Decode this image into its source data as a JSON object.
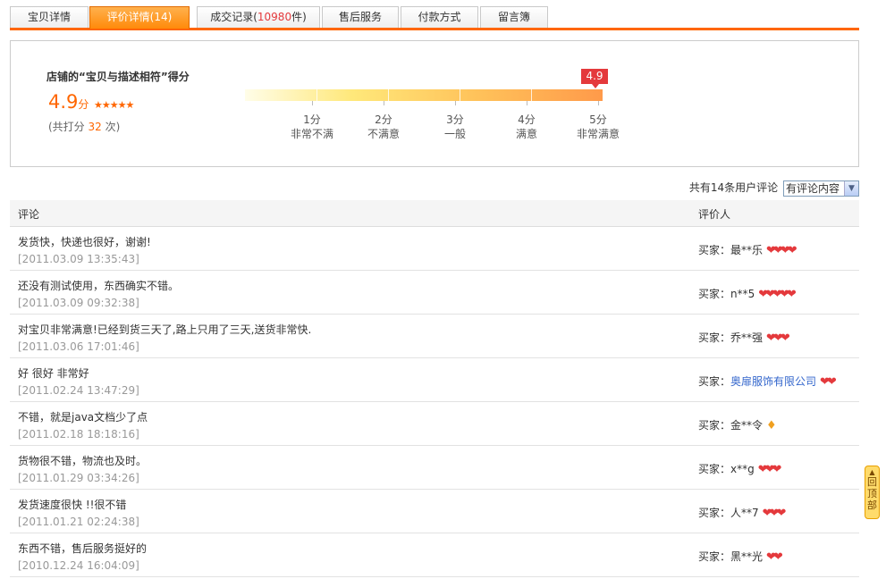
{
  "tabs": [
    {
      "label": "宝贝详情",
      "num": "",
      "suffix": ""
    },
    {
      "label": "评价详情(",
      "num": "14",
      "suffix": ")"
    },
    {
      "label": "成交记录(",
      "num": "10980",
      "suffix": "件)"
    },
    {
      "label": "售后服务",
      "num": "",
      "suffix": ""
    },
    {
      "label": "付款方式",
      "num": "",
      "suffix": ""
    },
    {
      "label": "留言簿",
      "num": "",
      "suffix": ""
    }
  ],
  "rating": {
    "title": "店铺的“宝贝与描述相符”得分",
    "score": "4.9",
    "score_unit": "分",
    "score_value": 4.9,
    "count_prefix": "(共打分",
    "count": "32",
    "count_suffix": "次)",
    "flag": "4.9",
    "scale": [
      {
        "score": "1分",
        "desc": "非常不满"
      },
      {
        "score": "2分",
        "desc": "不满意"
      },
      {
        "score": "3分",
        "desc": "一般"
      },
      {
        "score": "4分",
        "desc": "满意"
      },
      {
        "score": "5分",
        "desc": "非常满意"
      }
    ]
  },
  "sort": {
    "summary": "共有14条用户评论",
    "selected": "有评论内容"
  },
  "table": {
    "col_comment": "评论",
    "col_reviewer": "评价人",
    "rows": [
      {
        "text": "发货快，快递也很好，谢谢!",
        "date": "[2011.03.09 13:35:43]",
        "buyer_prefix": "买家：",
        "buyer": "最**乐",
        "hearts": "❤❤❤❤",
        "link": false,
        "diamond": false
      },
      {
        "text": "还没有测试使用，东西确实不错。",
        "date": "[2011.03.09 09:32:38]",
        "buyer_prefix": "买家：",
        "buyer": "n**5",
        "hearts": "❤❤❤❤❤",
        "link": false,
        "diamond": false
      },
      {
        "text": "对宝贝非常满意!已经到货三天了,路上只用了三天,送货非常快.",
        "date": "[2011.03.06 17:01:46]",
        "buyer_prefix": "买家：",
        "buyer": "乔**强",
        "hearts": "❤❤❤",
        "link": false,
        "diamond": false
      },
      {
        "text": "好 很好 非常好",
        "date": "[2011.02.24 13:47:29]",
        "buyer_prefix": "买家：",
        "buyer": "奥扉服饰有限公司",
        "hearts": "❤❤",
        "link": true,
        "diamond": false
      },
      {
        "text": "不错，就是java文档少了点",
        "date": "[2011.02.18 18:18:16]",
        "buyer_prefix": "买家：",
        "buyer": "金**令",
        "hearts": "♦",
        "link": false,
        "diamond": true
      },
      {
        "text": "货物很不错，物流也及时。",
        "date": "[2011.01.29 03:34:26]",
        "buyer_prefix": "买家：",
        "buyer": "x**g",
        "hearts": "❤❤❤",
        "link": false,
        "diamond": false
      },
      {
        "text": "发货速度很快 !!很不错",
        "date": "[2011.01.21 02:24:38]",
        "buyer_prefix": "买家：",
        "buyer": "人**7",
        "hearts": "❤❤❤",
        "link": false,
        "diamond": false
      },
      {
        "text": "东西不错，售后服务挺好的",
        "date": "[2010.12.24 16:04:09]",
        "buyer_prefix": "买家：",
        "buyer": "黑**光",
        "hearts": "❤❤",
        "link": false,
        "diamond": false
      }
    ]
  },
  "back_top": {
    "label": "回顶部"
  }
}
